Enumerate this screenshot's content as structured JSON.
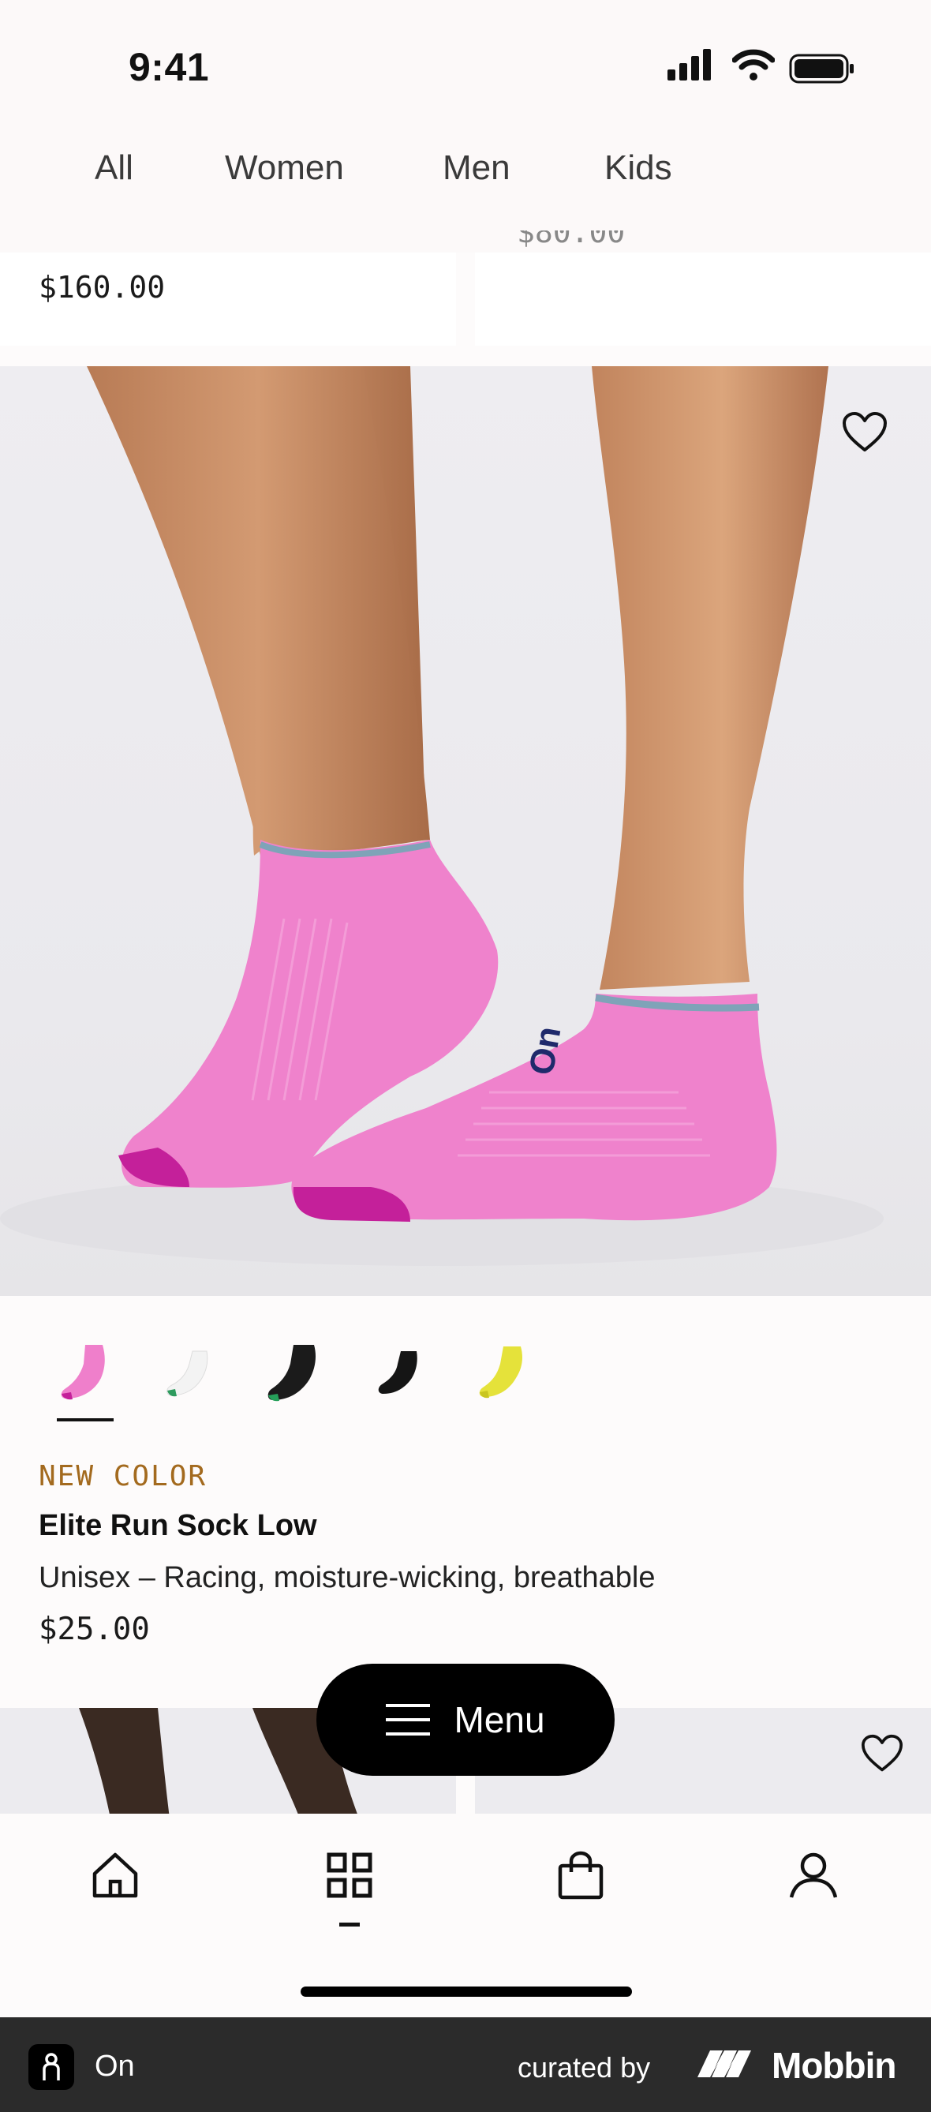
{
  "status_bar": {
    "time": "9:41"
  },
  "category_tabs": [
    {
      "label": "All"
    },
    {
      "label": "Women"
    },
    {
      "label": "Men"
    },
    {
      "label": "Kids"
    }
  ],
  "previous_row": {
    "left_price": "$160.00",
    "right_price": "$80.00"
  },
  "product": {
    "badge": "NEW COLOR",
    "name": "Elite Run Sock Low",
    "description": "Unisex – Racing, moisture-wicking, breathable",
    "price": "$25.00",
    "swatches": [
      {
        "color": "#ef7fcb",
        "accent": "#c4209a",
        "selected": true
      },
      {
        "color": "#f3f3f3",
        "accent": "#2e9b5e",
        "selected": false
      },
      {
        "color": "#1b1b1b",
        "accent": "#26a05a",
        "selected": false
      },
      {
        "color": "#151515",
        "accent": "#151515",
        "selected": false
      },
      {
        "color": "#e5e23a",
        "accent": "#c9c520",
        "selected": false
      }
    ]
  },
  "menu_button": {
    "label": "Menu"
  },
  "bottom_nav": [
    {
      "icon": "home-icon"
    },
    {
      "icon": "grid-icon",
      "active": true
    },
    {
      "icon": "bag-icon"
    },
    {
      "icon": "account-icon"
    }
  ],
  "footer": {
    "app_name": "On",
    "curated_by": "curated by",
    "brand": "Mobbin"
  },
  "colors": {
    "accent_badge": "#a36a1e",
    "sock_pink": "#ef82cc",
    "pill_bg": "#000000"
  }
}
